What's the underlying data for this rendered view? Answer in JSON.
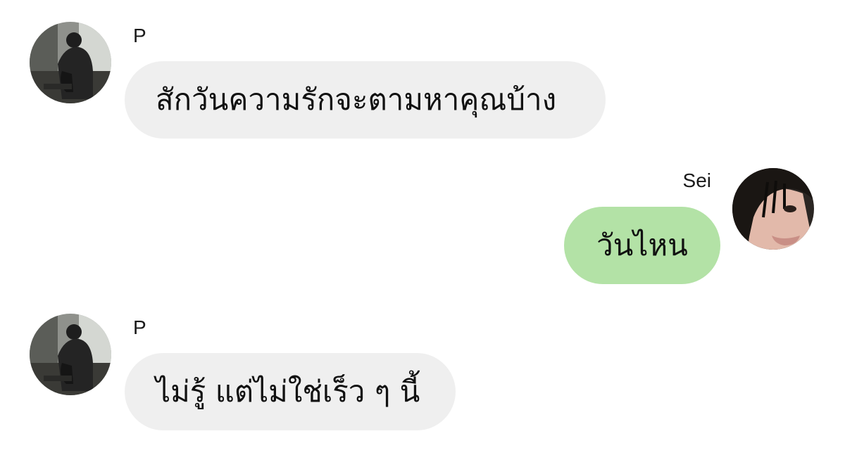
{
  "messages": [
    {
      "sender": "P",
      "direction": "incoming",
      "text": "สักวันความรักจะตามหาคุณบ้าง"
    },
    {
      "sender": "Sei",
      "direction": "outgoing",
      "text": "วันไหน"
    },
    {
      "sender": "P",
      "direction": "incoming",
      "text": "ไม่รู้ แต่ไม่ใช่เร็ว ๆ นี้"
    }
  ],
  "colors": {
    "incoming_bubble": "#efefef",
    "outgoing_bubble": "#b3e2a6",
    "background": "#ffffff"
  },
  "icons": {
    "p_avatar": "avatar-person-dark-photo",
    "sei_avatar": "avatar-face-closeup-photo"
  }
}
